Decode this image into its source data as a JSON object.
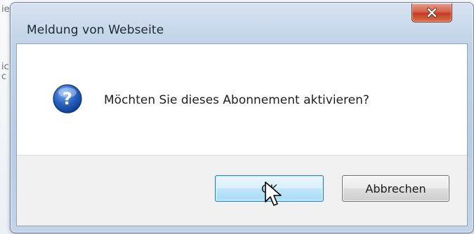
{
  "dialog": {
    "title": "Meldung von Webseite",
    "message": "Möchten Sie dieses Abonnement aktivieren?",
    "icon": "question-icon",
    "buttons": {
      "ok_label": "OK",
      "cancel_label": "Abbrechen"
    }
  },
  "background_fragments": {
    "char_1": "ie",
    "char_2": "ic",
    "char_3": "c"
  },
  "colors": {
    "close_button": "#c13c22",
    "ok_border": "#3c7fb1",
    "question_icon": "#2a64c5"
  }
}
